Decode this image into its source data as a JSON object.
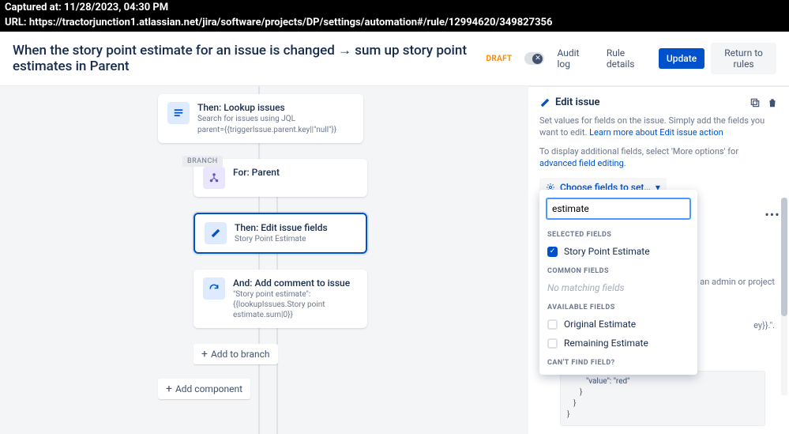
{
  "capture": {
    "time": "Captured at: 11/28/2023, 04:30 PM",
    "url": "URL: https://tractorjunction1.atlassian.net/jira/software/projects/DP/settings/automation#/rule/12994620/349827356"
  },
  "header": {
    "title": "When the story point estimate for an issue is changed → sum up story point estimates in Parent",
    "draft": "DRAFT",
    "audit_log": "Audit log",
    "rule_details": "Rule details",
    "update": "Update",
    "return": "Return to rules"
  },
  "flow": {
    "lookup": {
      "title": "Then: Lookup issues",
      "sub1": "Search for issues using JQL",
      "sub2": "parent={{triggerIssue.parent.key||\"null\"}}"
    },
    "branch_label": "BRANCH",
    "for_parent": {
      "title": "For: Parent"
    },
    "edit": {
      "title": "Then: Edit issue fields",
      "sub": "Story Point Estimate"
    },
    "comment": {
      "title": "And: Add comment to issue",
      "sub": "\"Story point estimate\": {{lookupIssues.Story point estimate.sum|0}}"
    },
    "add_branch": "Add to branch",
    "add_component": "Add component"
  },
  "panel": {
    "title": "Edit issue",
    "desc_pre": "Set values for fields on the issue. Simply add the fields you want to edit. ",
    "desc_link": "Learn more about Edit issue action",
    "desc2_pre": "To display additional fields, select 'More options' for ",
    "desc2_link": "advanced field editing",
    "desc2_post": ".",
    "chooser": "Choose fields to set…",
    "chevron": "▾",
    "side_hint": "t be an admin or project",
    "side_hint2": "ey}}.\".",
    "code_line1": "\"value\": \"red\"",
    "code_line2": "}",
    "code_line3": "}",
    "code_line4": "}"
  },
  "dropdown": {
    "search_value": "estimate",
    "selected_label": "SELECTED FIELDS",
    "selected_item": "Story Point Estimate",
    "common_label": "COMMON FIELDS",
    "common_none": "No matching fields",
    "avail_label": "AVAILABLE FIELDS",
    "avail_1": "Original Estimate",
    "avail_2": "Remaining Estimate",
    "cant_find": "CAN'T FIND FIELD?"
  }
}
